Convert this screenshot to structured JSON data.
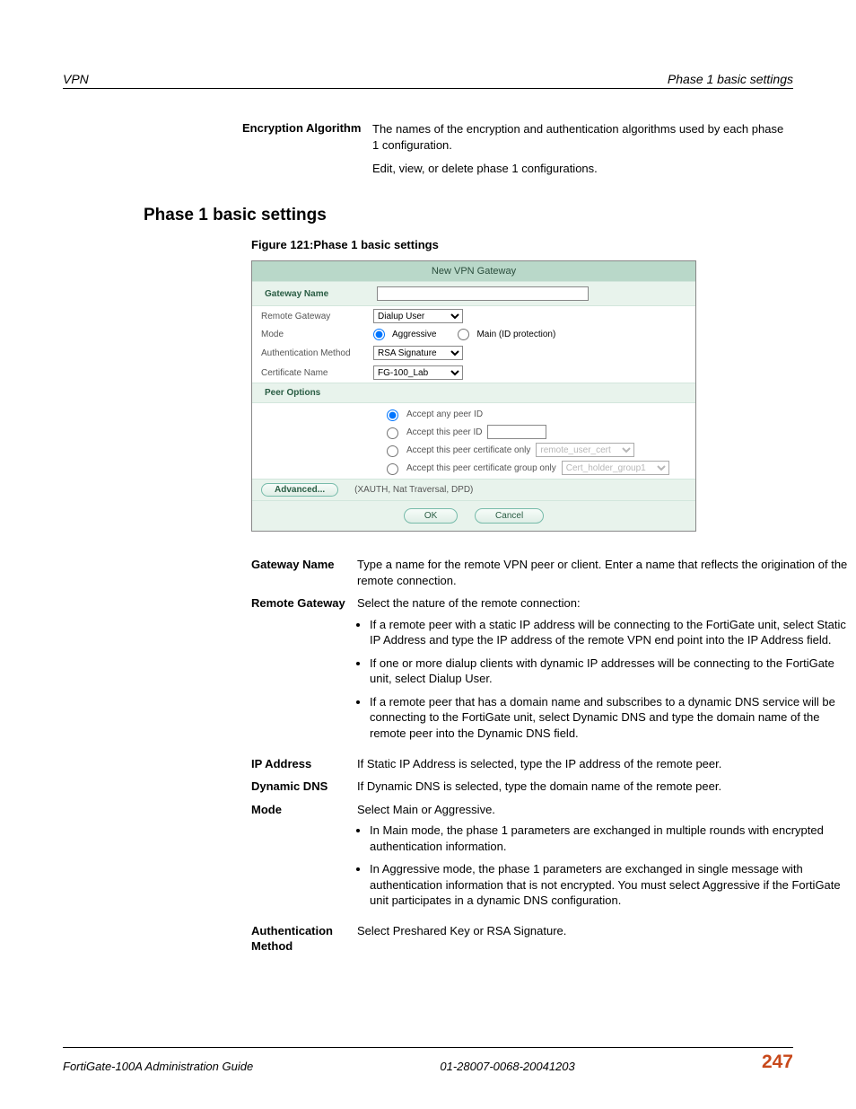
{
  "runningHead": {
    "left": "VPN",
    "right": "Phase 1 basic settings"
  },
  "encRow": {
    "label": "Encryption Algorithm",
    "text": "The names of the encryption and authentication algorithms used by each phase 1 configuration.",
    "sub": "Edit, view, or delete phase 1 configurations."
  },
  "heading": "Phase 1 basic settings",
  "figCaption": "Figure 121:Phase 1 basic settings",
  "shot": {
    "title": "New VPN Gateway",
    "gatewayNameLabel": "Gateway Name",
    "remoteGatewayLabel": "Remote Gateway",
    "remoteGatewayValue": "Dialup User",
    "modeLabel": "Mode",
    "modeAggressive": "Aggressive",
    "modeMain": "Main (ID protection)",
    "authMethodLabel": "Authentication Method",
    "authMethodValue": "RSA Signature",
    "certNameLabel": "Certificate Name",
    "certNameValue": "FG-100_Lab",
    "peerOptionsLabel": "Peer Options",
    "peer1": "Accept any peer ID",
    "peer2": "Accept this peer ID",
    "peer3": "Accept this peer certificate only",
    "peer3sel": "remote_user_cert",
    "peer4": "Accept this peer certificate group only",
    "peer4sel": "Cert_holder_group1",
    "advBtn": "Advanced...",
    "advNote": "(XAUTH, Nat Traversal, DPD)",
    "okBtn": "OK",
    "cancelBtn": "Cancel"
  },
  "defs": {
    "gatewayName": {
      "term": "Gateway Name",
      "text": "Type a name for the remote VPN peer or client. Enter a name that reflects the origination of the remote connection."
    },
    "remoteGateway": {
      "term": "Remote Gateway",
      "intro": "Select the nature of the remote connection:",
      "b1": "If a remote peer with a static IP address will be connecting to the FortiGate unit, select Static IP Address and type the IP address of the remote VPN end point into the IP Address field.",
      "b2": "If one or more dialup clients with dynamic IP addresses will be connecting to the FortiGate unit, select Dialup User.",
      "b3": "If a remote peer that has a domain name and subscribes to a dynamic DNS service will be connecting to the FortiGate unit, select Dynamic DNS and type the domain name of the remote peer into the Dynamic DNS field."
    },
    "ipAddress": {
      "term": "IP Address",
      "text": "If Static IP Address is selected, type the IP address of the remote peer."
    },
    "dynamicDNS": {
      "term": "Dynamic DNS",
      "text": "If Dynamic DNS is selected, type the domain name of the remote peer."
    },
    "mode": {
      "term": "Mode",
      "intro": "Select Main or Aggressive.",
      "b1": "In Main mode, the phase 1 parameters are exchanged in multiple rounds with encrypted authentication information.",
      "b2": "In Aggressive mode, the phase 1 parameters are exchanged in single message with authentication information that is not encrypted. You must select Aggressive if the FortiGate unit participates in a dynamic DNS configuration."
    },
    "authMethod": {
      "term": "Authentication Method",
      "text": "Select Preshared Key or RSA Signature."
    }
  },
  "footer": {
    "left": "FortiGate-100A Administration Guide",
    "center": "01-28007-0068-20041203",
    "page": "247"
  }
}
